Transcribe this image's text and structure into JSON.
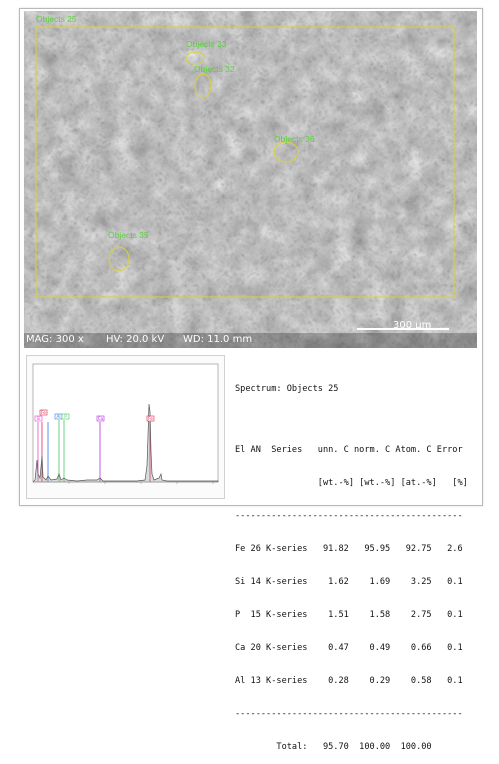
{
  "sem": {
    "objects_label": "Objects 25",
    "regions": [
      "Objects 33",
      "Objects 32",
      "Objects 36",
      "Objects 35"
    ],
    "mag": "MAG: 300 x",
    "hv": "HV: 20.0 kV",
    "wd": "WD: 11.0 mm",
    "scale": "300 µm"
  },
  "spectrum_table": {
    "title": "Spectrum: Objects 25",
    "header1": "El AN  Series   unn. C norm. C Atom. C Error",
    "header2": "                [wt.-%] [wt.-%] [at.-%]   [%]",
    "separator": "--------------------------------------------",
    "rows": [
      "Fe 26 K-series   91.82   95.95   92.75   2.6",
      "Si 14 K-series    1.62    1.69    3.25   0.1",
      "P  15 K-series    1.51    1.58    2.75   0.1",
      "Ca 20 K-series    0.47    0.49    0.66   0.1",
      "Al 13 K-series    0.28    0.29    0.58   0.1"
    ],
    "total_separator": "--------------------------------------------",
    "total": "        Total:   95.70  100.00  100.00"
  },
  "plot": {
    "peak_labels": [
      "Fe",
      "Si",
      "P",
      "Ca",
      "Fe",
      "Fe",
      "Al"
    ],
    "colors": {
      "fe": "#d8294e",
      "si": "#e24cc9",
      "p": "#46c86a",
      "ca": "#b52de0",
      "al": "#2e7cf0"
    }
  }
}
